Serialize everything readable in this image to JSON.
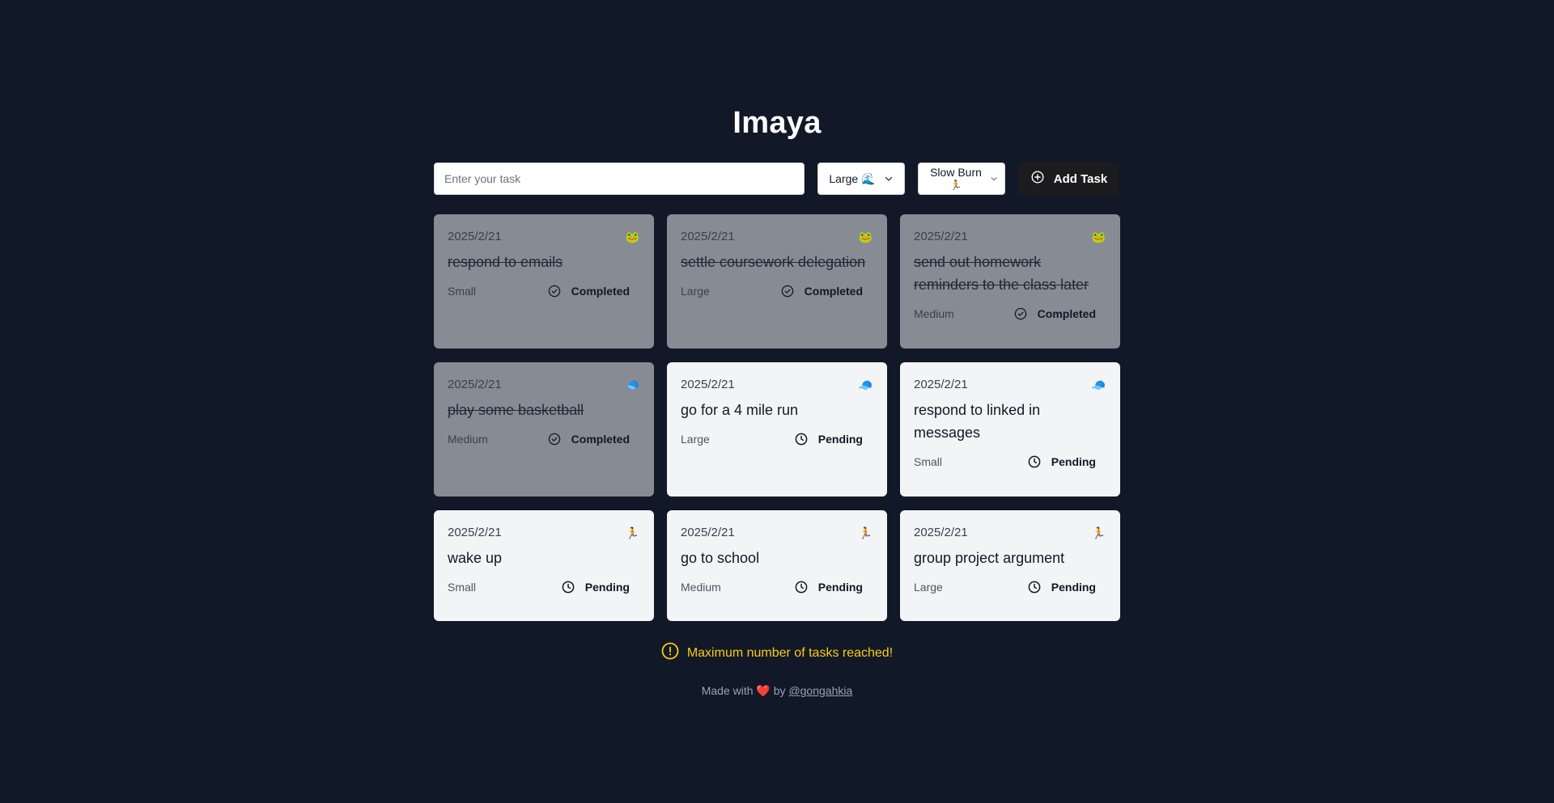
{
  "app": {
    "title": "Imaya"
  },
  "form": {
    "task_placeholder": "Enter your task",
    "size_select": {
      "value": "Large",
      "emoji": "🌊"
    },
    "energy_select": {
      "value": "Slow Burn",
      "emoji": "🏃"
    },
    "add_button_label": "Add Task"
  },
  "tasks": [
    {
      "date": "2025/2/21",
      "title": "respond to emails",
      "size": "Small",
      "status": "Completed",
      "energy_emoji": "🐸"
    },
    {
      "date": "2025/2/21",
      "title": "settle coursework delegation",
      "size": "Large",
      "status": "Completed",
      "energy_emoji": "🐸"
    },
    {
      "date": "2025/2/21",
      "title": "send out homework reminders to the class later",
      "size": "Medium",
      "status": "Completed",
      "energy_emoji": "🐸"
    },
    {
      "date": "2025/2/21",
      "title": "play some basketball",
      "size": "Medium",
      "status": "Completed",
      "energy_emoji": "🧢"
    },
    {
      "date": "2025/2/21",
      "title": "go for a 4 mile run",
      "size": "Large",
      "status": "Pending",
      "energy_emoji": "🧢"
    },
    {
      "date": "2025/2/21",
      "title": "respond to linked in messages",
      "size": "Small",
      "status": "Pending",
      "energy_emoji": "🧢"
    },
    {
      "date": "2025/2/21",
      "title": "wake up",
      "size": "Small",
      "status": "Pending",
      "energy_emoji": "🏃"
    },
    {
      "date": "2025/2/21",
      "title": "go to school",
      "size": "Medium",
      "status": "Pending",
      "energy_emoji": "🏃"
    },
    {
      "date": "2025/2/21",
      "title": "group project argument",
      "size": "Large",
      "status": "Pending",
      "energy_emoji": "🏃"
    }
  ],
  "warning": {
    "text": "Maximum number of tasks reached!",
    "color": "#facc15"
  },
  "footer": {
    "prefix": "Made with",
    "heart": "❤️",
    "by": "by",
    "link_text": "@gongahkia"
  },
  "colors": {
    "background": "#111827",
    "completed_card": "#878b94",
    "pending_card": "#f3f4f6",
    "button": "#1c1c1e"
  }
}
